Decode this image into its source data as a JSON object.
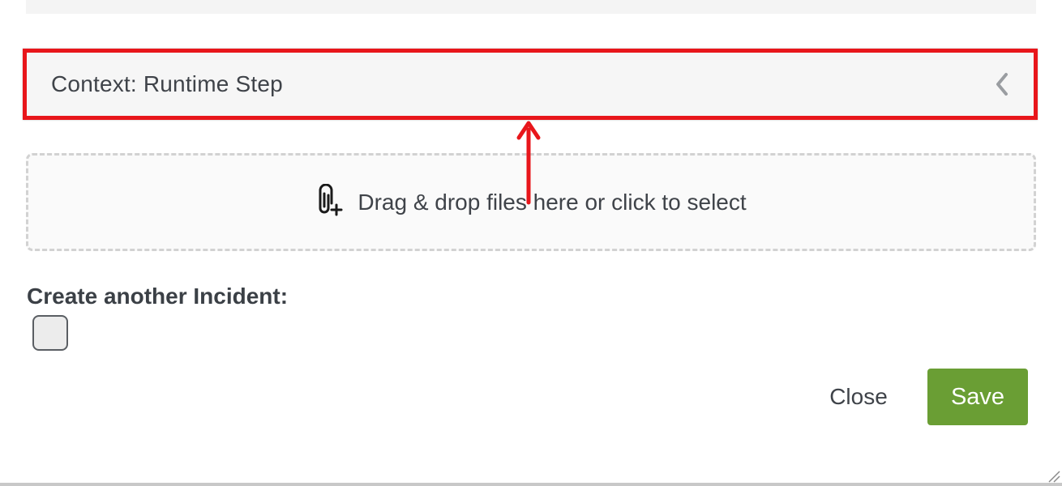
{
  "context": {
    "title": "Context: Runtime Step",
    "toggle_icon": "chevron-left-icon"
  },
  "dropzone": {
    "icon": "paperclip-plus-icon",
    "text": "Drag & drop files here or click to select"
  },
  "incident": {
    "label": "Create another Incident:",
    "checked": false
  },
  "footer": {
    "close_label": "Close",
    "save_label": "Save"
  },
  "colors": {
    "highlight": "#e8161b",
    "save_button": "#6a9e34",
    "panel_bg": "#f6f6f6"
  }
}
